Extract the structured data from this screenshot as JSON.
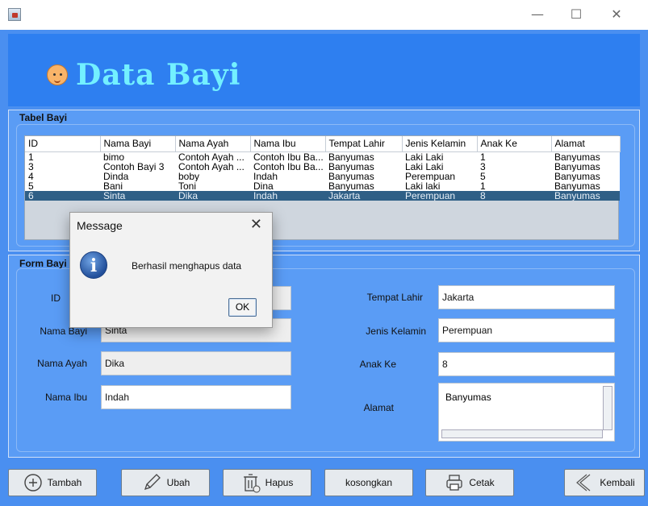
{
  "window": {
    "minimize": "—",
    "maximize": "☐",
    "close": "✕"
  },
  "header": {
    "title": "Data Bayi"
  },
  "table_panel": {
    "label": "Tabel Bayi",
    "columns": [
      "ID",
      "Nama Bayi",
      "Nama Ayah",
      "Nama Ibu",
      "Tempat Lahir",
      "Jenis Kelamin",
      "Anak Ke",
      "Alamat"
    ],
    "rows": [
      [
        "1",
        "bimo",
        "Contoh Ayah ...",
        "Contoh Ibu Ba...",
        "Banyumas",
        "Laki Laki",
        "1",
        "Banyumas"
      ],
      [
        "3",
        "Contoh Bayi 3",
        "Contoh Ayah ...",
        "Contoh Ibu Ba...",
        "Banyumas",
        "Laki Laki",
        "3",
        "Banyumas"
      ],
      [
        "4",
        "Dinda",
        "boby",
        "Indah",
        "Banyumas",
        "Perempuan",
        "5",
        "Banyumas"
      ],
      [
        "5",
        "Bani",
        "Toni",
        "Dina",
        "Banyumas",
        "Laki laki",
        "1",
        "Banyumas"
      ],
      [
        "6",
        "Sinta",
        "Dika",
        "Indah",
        "Jakarta",
        "Perempuan",
        "8",
        "Banyumas"
      ]
    ],
    "selected_row": 4
  },
  "form_panel": {
    "label": "Form Bayi",
    "id_label": "ID",
    "nama_bayi_label": "Nama Bayi",
    "nama_bayi_value": "Sinta",
    "nama_ayah_label": "Nama Ayah",
    "nama_ayah_value": "Dika",
    "nama_ibu_label": "Nama Ibu",
    "nama_ibu_value": "Indah",
    "tempat_lahir_label": "Tempat Lahir",
    "tempat_lahir_value": "Jakarta",
    "jenis_kelamin_label": "Jenis Kelamin",
    "jenis_kelamin_value": "Perempuan",
    "anak_ke_label": "Anak Ke",
    "anak_ke_value": "8",
    "alamat_label": "Alamat",
    "alamat_value": "Banyumas"
  },
  "buttons": {
    "tambah": "Tambah",
    "ubah": "Ubah",
    "hapus": "Hapus",
    "kosongkan": "kosongkan",
    "cetak": "Cetak",
    "kembali": "Kembali"
  },
  "dialog": {
    "title": "Message",
    "message": "Berhasil menghapus data",
    "ok": "OK",
    "close": "✕"
  },
  "colors": {
    "background": "#4a8ff0",
    "header_band": "#2e7ff0",
    "title_text": "#73f0ff",
    "selected_row": "#2f5f86"
  }
}
